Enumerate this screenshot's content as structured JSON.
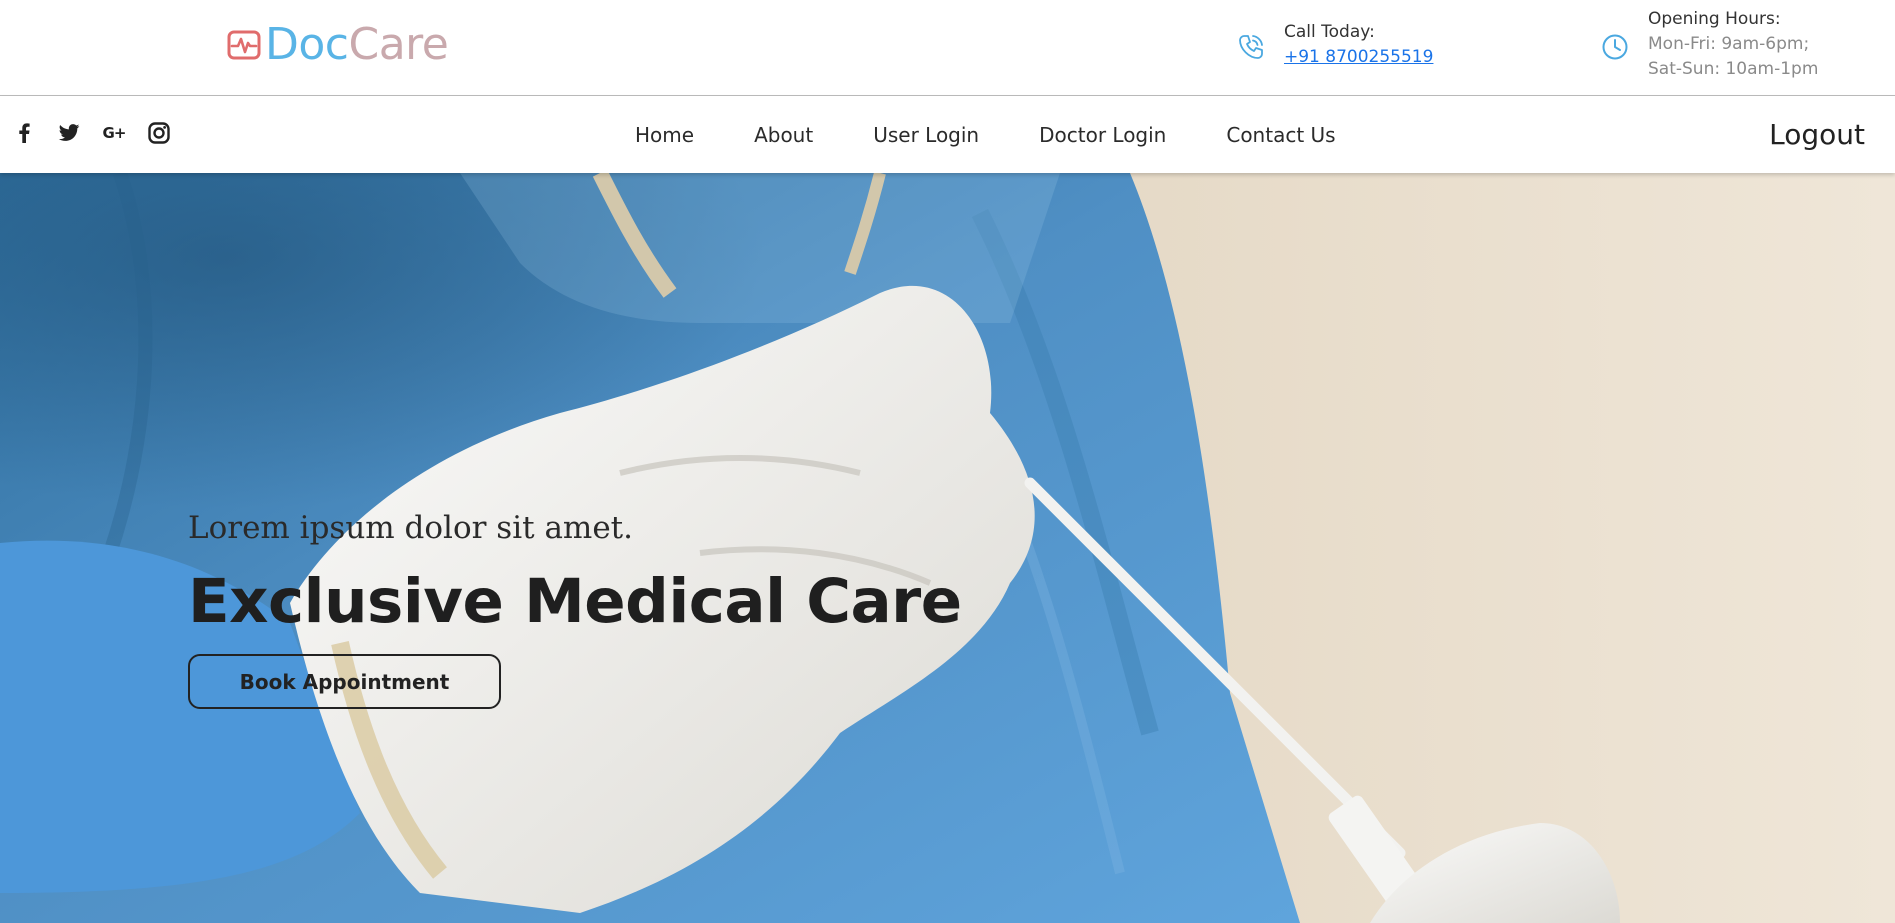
{
  "brand": {
    "name_part1": "Doc",
    "name_part2": "Care",
    "logo_icon": "heart-pulse-icon",
    "color_primary": "#59b4e6",
    "color_secondary": "#c9a9ad",
    "icon_color": "#e06c6c"
  },
  "header": {
    "call": {
      "icon": "phone-icon",
      "title": "Call Today:",
      "phone": "+91 8700255519"
    },
    "hours": {
      "icon": "clock-icon",
      "title": "Opening Hours:",
      "weekday": "Mon-Fri: 9am-6pm;",
      "weekend": "Sat-Sun: 10am-1pm"
    },
    "accent_color": "#4aa8e0"
  },
  "social": {
    "items": [
      "facebook-icon",
      "twitter-icon",
      "google-plus-icon",
      "instagram-icon"
    ],
    "google_plus_text": "G+"
  },
  "nav": {
    "items": [
      "Home",
      "About",
      "User Login",
      "Doctor Login",
      "Contact Us"
    ],
    "logout": "Logout"
  },
  "hero": {
    "tagline": "Lorem ipsum dolor sit amet.",
    "title": "Exclusive Medical Care",
    "cta": "Book Appointment"
  }
}
